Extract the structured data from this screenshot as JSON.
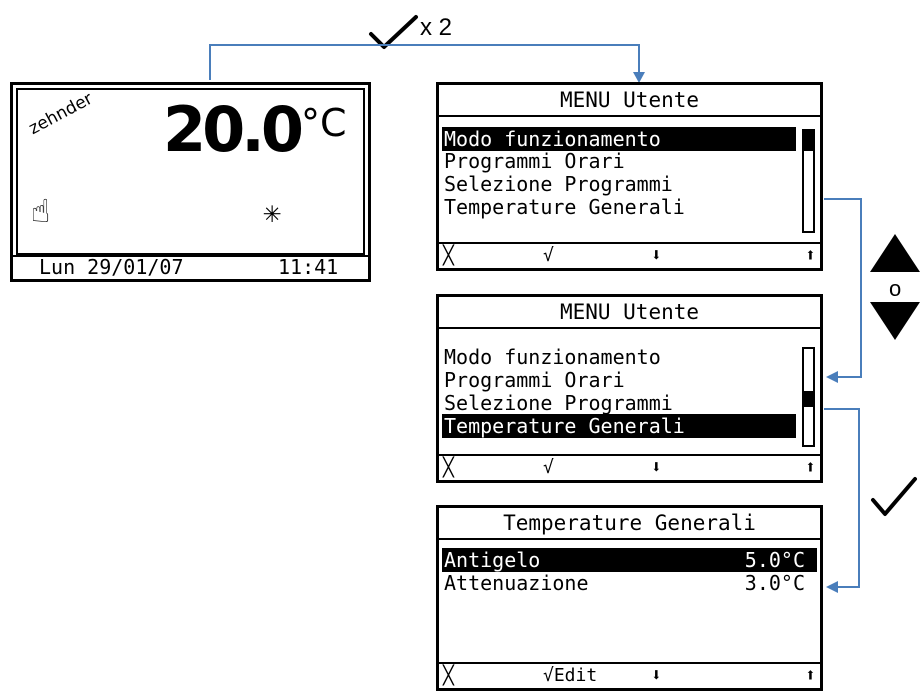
{
  "confirm_times": "x 2",
  "or_label": "o",
  "home": {
    "brand": "zehnder",
    "temperature": "20.0",
    "unit": "°C",
    "date": "Lun 29/01/07",
    "time": "11:41",
    "mode_icon": "snowflake-icon",
    "hand_icon": "hand-pointer-icon"
  },
  "menu1": {
    "title": "MENU Utente",
    "items": [
      "Modo funzionamento",
      "Programmi Orari",
      "Selezione Programmi",
      "Temperature Generali"
    ],
    "selected_index": 0,
    "scroll_position": 0.0,
    "softkeys": [
      "╳",
      "√",
      "⬇",
      "⬆"
    ]
  },
  "menu2": {
    "title": "MENU Utente",
    "items": [
      "Modo funzionamento",
      "Programmi Orari",
      "Selezione Programmi",
      "Temperature Generali"
    ],
    "selected_index": 3,
    "scroll_position": 0.5,
    "softkeys": [
      "╳",
      "√",
      "⬇",
      "⬆"
    ]
  },
  "temps": {
    "title": "Temperature Generali",
    "rows": [
      {
        "label": "Antigelo",
        "value": "5.0°C"
      },
      {
        "label": "Attenuazione",
        "value": "3.0°C"
      }
    ],
    "selected_index": 0,
    "softkeys": [
      "╳",
      "√Edit",
      "⬇",
      "⬆"
    ]
  },
  "colors": {
    "connector": "#4a7ebb",
    "lcd": "#000000"
  }
}
